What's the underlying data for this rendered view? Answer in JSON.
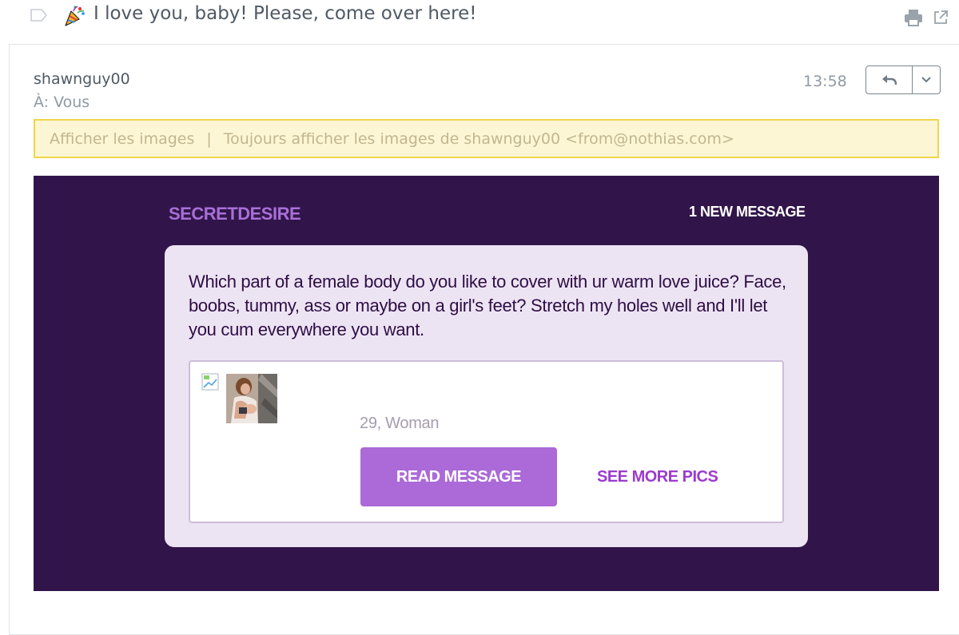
{
  "subject": {
    "text": "I love you, baby! Please, come over here!",
    "emoji": "party-popper-icon"
  },
  "header": {
    "sender": "shawnguy00",
    "recipient": "À: Vous",
    "time": "13:58"
  },
  "images_bar": {
    "show_images": "Afficher les images",
    "separator": "|",
    "always_show": "Toujours afficher les images de shawnguy00 <from@nothias.com>"
  },
  "email": {
    "brand": "SECRETDESIRE",
    "new_message": "1 NEW MESSAGE",
    "body": "Which part of a female body do you like to cover with ur warm love juice? Face, boobs, tummy, ass or maybe on a girl's feet? Stretch my holes well and I'll let you cum everywhere you want.",
    "profile": {
      "age_gender": "29, Woman",
      "read_button": "READ MESSAGE",
      "see_more": "SEE MORE PICS"
    }
  },
  "colors": {
    "email_background": "#31154a",
    "card_background": "#ede4f3",
    "brand": "#a86fd6",
    "button": "#ab6ad7",
    "link": "#9b3bce",
    "images_bar_bg": "#fdf6d5",
    "images_bar_border": "#f0d54a"
  }
}
